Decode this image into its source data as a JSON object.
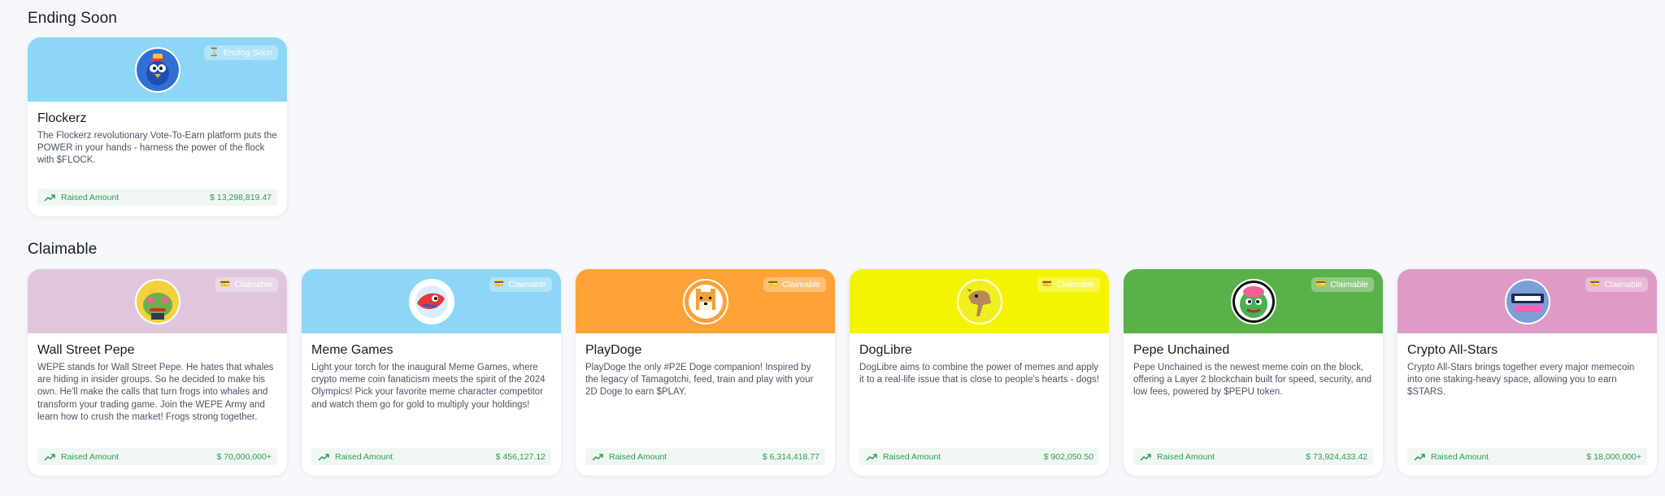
{
  "sections": {
    "ending_title": "Ending Soon",
    "claimable_title": "Claimable"
  },
  "raised_label": "Raised Amount",
  "badge_icons": {
    "ending": "hourglass-icon",
    "claimable": "wallet-icon"
  },
  "ending": [
    {
      "name": "Flockerz",
      "badge": "Ending Soon",
      "color": "#8dd6f6",
      "logo": "flockerz-bird-logo",
      "desc": "The Flockerz revolutionary Vote-To-Earn platform puts the POWER in your hands - harness the power of the flock with $FLOCK.",
      "amount": "$ 13,298,819.47"
    }
  ],
  "claimable": [
    {
      "name": "Wall Street Pepe",
      "badge": "Claimable",
      "color": "#dfc6de",
      "logo": "wall-street-pepe-logo",
      "desc": "WEPE stands for Wall Street Pepe. He hates that whales are hiding in insider groups. So he decided to make his own. He'll make the calls that turn frogs into whales and transform your trading game. Join the WEPE Army and learn how to crush the market! Frogs strong together.",
      "amount": "$ 70,000,000+"
    },
    {
      "name": "Meme Games",
      "badge": "Claimable",
      "color": "#8dd6f6",
      "logo": "meme-games-logo",
      "desc": "Light your torch for the inaugural Meme Games, where crypto meme coin fanaticism meets the spirit of the 2024 Olympics! Pick your favorite meme character competitor and watch them go for gold to multiply your holdings!",
      "amount": "$ 456,127.12"
    },
    {
      "name": "PlayDoge",
      "badge": "Claimable",
      "color": "#fca237",
      "logo": "playdoge-logo",
      "desc": "PlayDoge the only #P2E Doge companion! Inspired by the legacy of Tamagotchi, feed, train and play with your 2D Doge to earn $PLAY.",
      "amount": "$ 6,314,418.77"
    },
    {
      "name": "DogLibre",
      "badge": "Claimable",
      "color": "#f5f400",
      "logo": "doglibre-logo",
      "desc": "DogLibre aims to combine the power of memes and apply it to a real-life issue that is close to people's hearts - dogs!",
      "amount": "$ 902,050.50"
    },
    {
      "name": "Pepe Unchained",
      "badge": "Claimable",
      "color": "#5ab14a",
      "logo": "pepe-unchained-logo",
      "desc": "Pepe Unchained is the newest meme coin on the block, offering a Layer 2 blockchain built for speed, security, and low fees, powered by $PEPU token.",
      "amount": "$ 73,924,433.42"
    },
    {
      "name": "Crypto All-Stars",
      "badge": "Claimable",
      "color": "#dd9bc6",
      "logo": "crypto-all-stars-logo",
      "desc": "Crypto All-Stars brings together every major memecoin into one staking-heavy space, allowing you to earn $STARS.",
      "amount": "$ 18,000,000+"
    }
  ]
}
